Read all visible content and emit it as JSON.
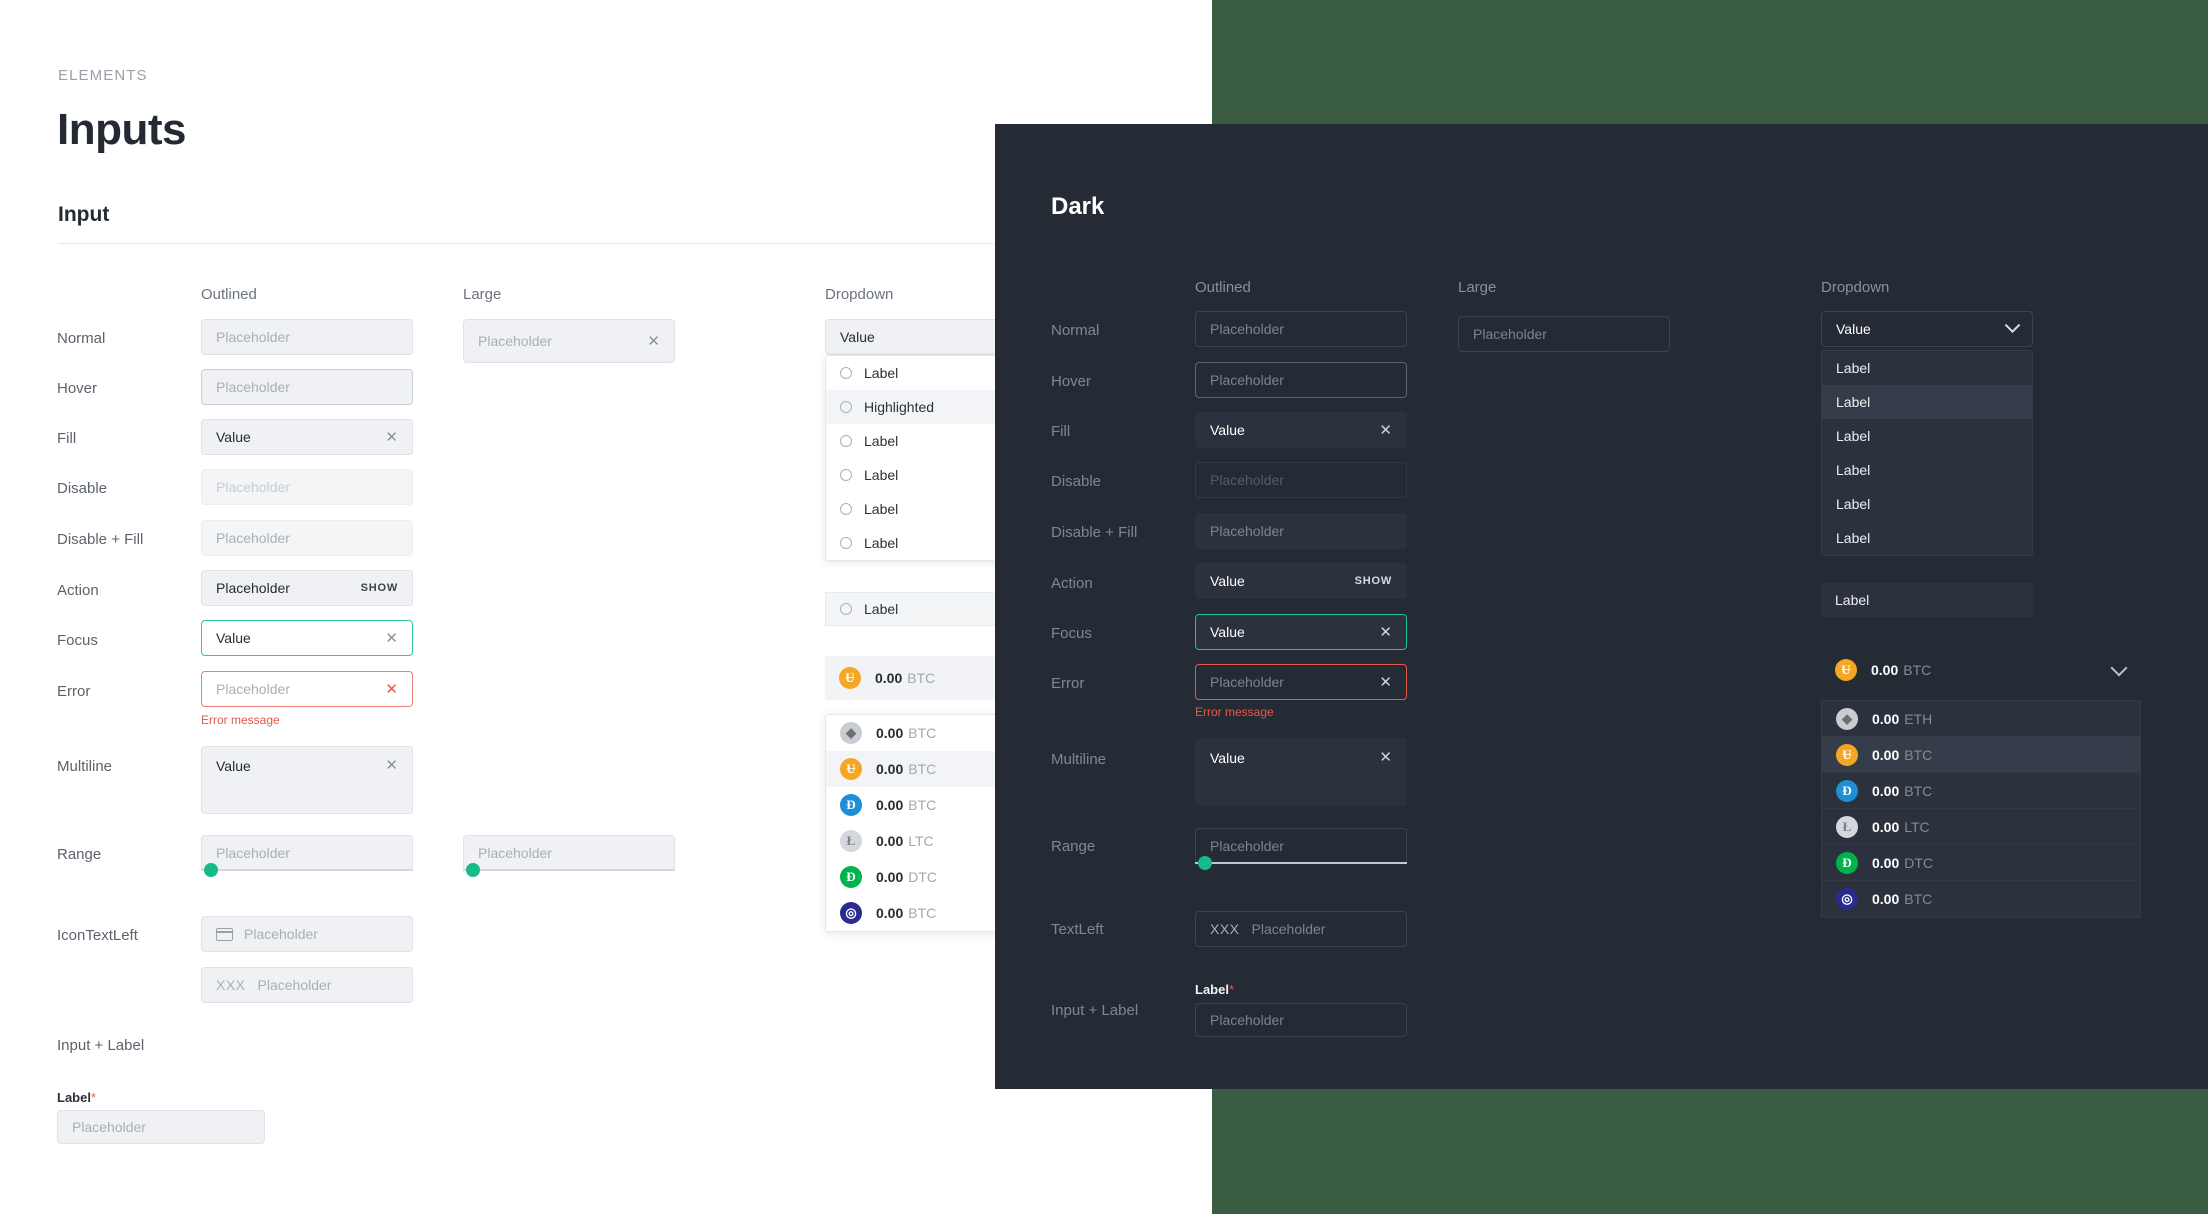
{
  "light": {
    "eyebrow": "ELEMENTS",
    "page_title": "Inputs",
    "section_title": "Input",
    "columns": {
      "outlined": "Outlined",
      "large": "Large",
      "dropdown": "Dropdown"
    },
    "rows": {
      "normal": "Normal",
      "hover": "Hover",
      "fill": "Fill",
      "disable": "Disable",
      "disable_fill": "Disable + Fill",
      "action": "Action",
      "focus": "Focus",
      "error": "Error",
      "multiline": "Multiline",
      "range": "Range",
      "icon_text_left": "IconTextLeft",
      "input_plus_label": "Input + Label"
    },
    "values": {
      "placeholder": "Placeholder",
      "value": "Value",
      "show": "SHOW",
      "error_message": "Error message",
      "xxx_prefix": "XXX",
      "label": "Label",
      "required_mark": "*"
    },
    "dropdown_selected": "Value",
    "dropdown_options": [
      {
        "label": "Label",
        "highlighted": false
      },
      {
        "label": "Highlighted",
        "highlighted": true
      },
      {
        "label": "Label",
        "highlighted": false
      },
      {
        "label": "Label",
        "highlighted": false
      },
      {
        "label": "Label",
        "highlighted": false
      },
      {
        "label": "Label",
        "highlighted": false
      }
    ],
    "dropdown_solo_option": "Label",
    "crypto_selected": {
      "amount": "0.00",
      "ticker": "BTC",
      "coin": "bitcoin-icon",
      "color": "#f5a623",
      "glyph": "Ƀ"
    },
    "crypto_options": [
      {
        "amount": "0.00",
        "ticker": "BTC",
        "coin": "ethereum-icon",
        "color": "#c9ccd1",
        "glyph": "◆",
        "highlighted": false
      },
      {
        "amount": "0.00",
        "ticker": "BTC",
        "coin": "bitcoin-icon",
        "color": "#f5a623",
        "glyph": "Ƀ",
        "highlighted": true
      },
      {
        "amount": "0.00",
        "ticker": "BTC",
        "coin": "dash-icon",
        "color": "#1e8fd5",
        "glyph": "Đ",
        "highlighted": false
      },
      {
        "amount": "0.00",
        "ticker": "LTC",
        "coin": "litecoin-icon",
        "color": "#d4d7db",
        "glyph": "Ł",
        "highlighted": false
      },
      {
        "amount": "0.00",
        "ticker": "DTC",
        "coin": "dogecoin-icon",
        "color": "#00b34a",
        "glyph": "Ð",
        "highlighted": false
      },
      {
        "amount": "0.00",
        "ticker": "BTC",
        "coin": "zcoin-icon",
        "color": "#2b2b8f",
        "glyph": "◎",
        "highlighted": false
      }
    ]
  },
  "dark": {
    "title": "Dark",
    "columns": {
      "outlined": "Outlined",
      "large": "Large",
      "dropdown": "Dropdown"
    },
    "rows": {
      "normal": "Normal",
      "hover": "Hover",
      "fill": "Fill",
      "disable": "Disable",
      "disable_fill": "Disable + Fill",
      "action": "Action",
      "focus": "Focus",
      "error": "Error",
      "multiline": "Multiline",
      "range": "Range",
      "text_left": "TextLeft",
      "input_plus_label": "Input + Label"
    },
    "values": {
      "placeholder": "Placeholder",
      "value": "Value",
      "show": "SHOW",
      "error_message": "Error message",
      "xxx_prefix": "XXX",
      "label": "Label",
      "required_mark": "*"
    },
    "dropdown_selected": "Value",
    "dropdown_options": [
      {
        "label": "Label",
        "highlighted": false
      },
      {
        "label": "Label",
        "highlighted": true
      },
      {
        "label": "Label",
        "highlighted": false
      },
      {
        "label": "Label",
        "highlighted": false
      },
      {
        "label": "Label",
        "highlighted": false
      },
      {
        "label": "Label",
        "highlighted": false
      }
    ],
    "dropdown_solo_option": "Label",
    "crypto_selected": {
      "amount": "0.00",
      "ticker": "BTC",
      "coin": "bitcoin-icon",
      "color": "#f5a623",
      "glyph": "Ƀ"
    },
    "crypto_options": [
      {
        "amount": "0.00",
        "ticker": "ETH",
        "coin": "ethereum-icon",
        "color": "#c9ccd1",
        "glyph": "◆",
        "highlighted": false
      },
      {
        "amount": "0.00",
        "ticker": "BTC",
        "coin": "bitcoin-icon",
        "color": "#f5a623",
        "glyph": "Ƀ",
        "highlighted": true
      },
      {
        "amount": "0.00",
        "ticker": "BTC",
        "coin": "dash-icon",
        "color": "#1e8fd5",
        "glyph": "Đ",
        "highlighted": false
      },
      {
        "amount": "0.00",
        "ticker": "LTC",
        "coin": "litecoin-icon",
        "color": "#d4d7db",
        "glyph": "Ł",
        "highlighted": false
      },
      {
        "amount": "0.00",
        "ticker": "DTC",
        "coin": "dogecoin-icon",
        "color": "#00b34a",
        "glyph": "Ð",
        "highlighted": false
      },
      {
        "amount": "0.00",
        "ticker": "BTC",
        "coin": "zcoin-icon",
        "color": "#2b2b8f",
        "glyph": "◎",
        "highlighted": false
      }
    ]
  },
  "theme": {
    "accent_teal": "#18b98a",
    "error_red": "#e05a4a",
    "dark_bg": "#252b35",
    "green_backdrop": "#3a5c42"
  }
}
